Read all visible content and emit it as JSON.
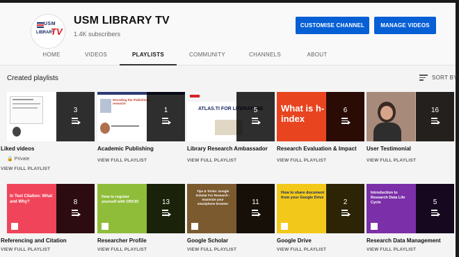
{
  "channel": {
    "name": "USM LIBRARY TV",
    "subscribers": "1.4K subscribers",
    "logo_text_usm": "USM",
    "logo_text_library": "LIBRARY",
    "logo_text_tv": "TV",
    "brand_blue": "#1c2a63",
    "brand_red": "#d81f26"
  },
  "buttons": {
    "customise": "CUSTOMISE CHANNEL",
    "manage": "MANAGE VIDEOS",
    "accent": "#065fd4"
  },
  "tabs": [
    {
      "label": "HOME"
    },
    {
      "label": "VIDEOS"
    },
    {
      "label": "PLAYLISTS",
      "active": true
    },
    {
      "label": "COMMUNITY"
    },
    {
      "label": "CHANNELS"
    },
    {
      "label": "ABOUT"
    }
  ],
  "section": {
    "title": "Created playlists",
    "sort_label": "SORT BY",
    "sort_icon": "sort-icon"
  },
  "view_full_playlist": "VIEW FULL PLAYLIST",
  "playlists": [
    {
      "title": "Liked videos",
      "count": "3",
      "private": "Private",
      "thumb_color": "#ffffff"
    },
    {
      "title": "Academic Publishing",
      "count": "1",
      "thumb_color": "#ffffff",
      "thumb_text": "Decoding the Publishing research"
    },
    {
      "title": "Library Research Ambassador",
      "count": "5",
      "thumb_color": "#ffffff",
      "thumb_text": "ATLAS.TI FOR LITERATURE"
    },
    {
      "title": "Research Evaluation & Impact",
      "count": "6",
      "thumb_color": "#e8441f",
      "thumb_text": "What is h-index"
    },
    {
      "title": "User Testimonial",
      "count": "16",
      "thumb_color": "#8a6a5e"
    },
    {
      "title": "Referencing and Citation",
      "count": "8",
      "thumb_color": "#f0445a",
      "thumb_text": "In Text Citation: What and Why?"
    },
    {
      "title": "Researcher Profile",
      "count": "13",
      "thumb_color": "#8fbd3a",
      "thumb_text": "How to register yourself with ORCID"
    },
    {
      "title": "Google Scholar",
      "count": "11",
      "thumb_color": "#7a5a2e",
      "thumb_text": "Tips & Tricks: Google Scholar For Research - maximize your smartphone browser"
    },
    {
      "title": "Google Drive",
      "count": "2",
      "thumb_color": "#f2c91a",
      "thumb_text": "How to share document from your Google Drive"
    },
    {
      "title": "Research Data Management",
      "count": "5",
      "thumb_color": "#7b2fa8",
      "thumb_text": "Introduction to Research Data Life Cycle"
    }
  ]
}
